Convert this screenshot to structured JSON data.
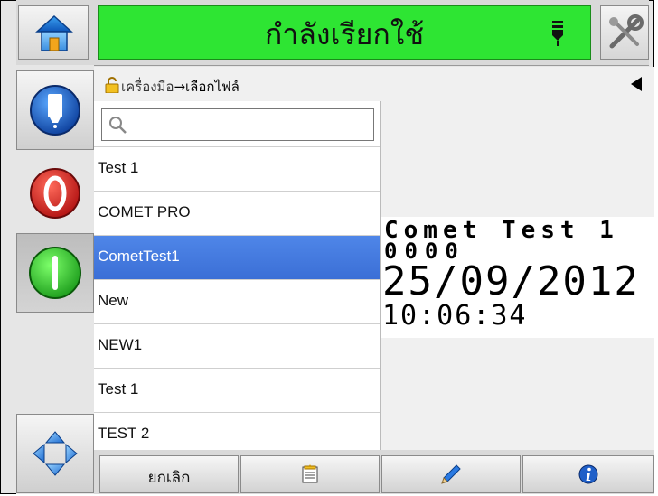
{
  "header": {
    "status_text": "กำลังเรียกใช้",
    "status_color": "#2ee533",
    "home_icon": "home-icon",
    "status_icon": "printhead-icon",
    "tools_icon": "tools-icon"
  },
  "left_buttons": [
    {
      "name": "ink-button",
      "icon": "ink-cartridge-icon"
    },
    {
      "name": "stop-button",
      "icon": "stop-icon",
      "color": "#e02020"
    },
    {
      "name": "start-button",
      "icon": "start-icon",
      "color": "#2ecc2e"
    },
    {
      "name": "navigation-button",
      "icon": "navigation-arrows-icon"
    }
  ],
  "breadcrumb": {
    "lock_icon": "lock-icon",
    "first": "เครื่องมือ",
    "separator": "→",
    "current": "เลือกไฟล์",
    "back_icon": "back-arrow-icon"
  },
  "search": {
    "icon": "search-icon",
    "value": ""
  },
  "files": [
    {
      "label": "Test 1",
      "selected": false
    },
    {
      "label": "COMET PRO",
      "selected": false
    },
    {
      "label": "CometTest1",
      "selected": true
    },
    {
      "label": "New",
      "selected": false
    },
    {
      "label": "NEW1",
      "selected": false
    },
    {
      "label": "Test 1",
      "selected": false
    },
    {
      "label": "TEST 2",
      "selected": false
    }
  ],
  "preview": {
    "line1": "Comet Test 1",
    "line2": "0000",
    "line3": "25/09/2012",
    "line4": "10:06:34"
  },
  "toolbar": {
    "cancel_label": "ยกเลิก",
    "new_icon": "new-file-icon",
    "edit_icon": "pencil-icon",
    "info_icon": "info-icon"
  }
}
